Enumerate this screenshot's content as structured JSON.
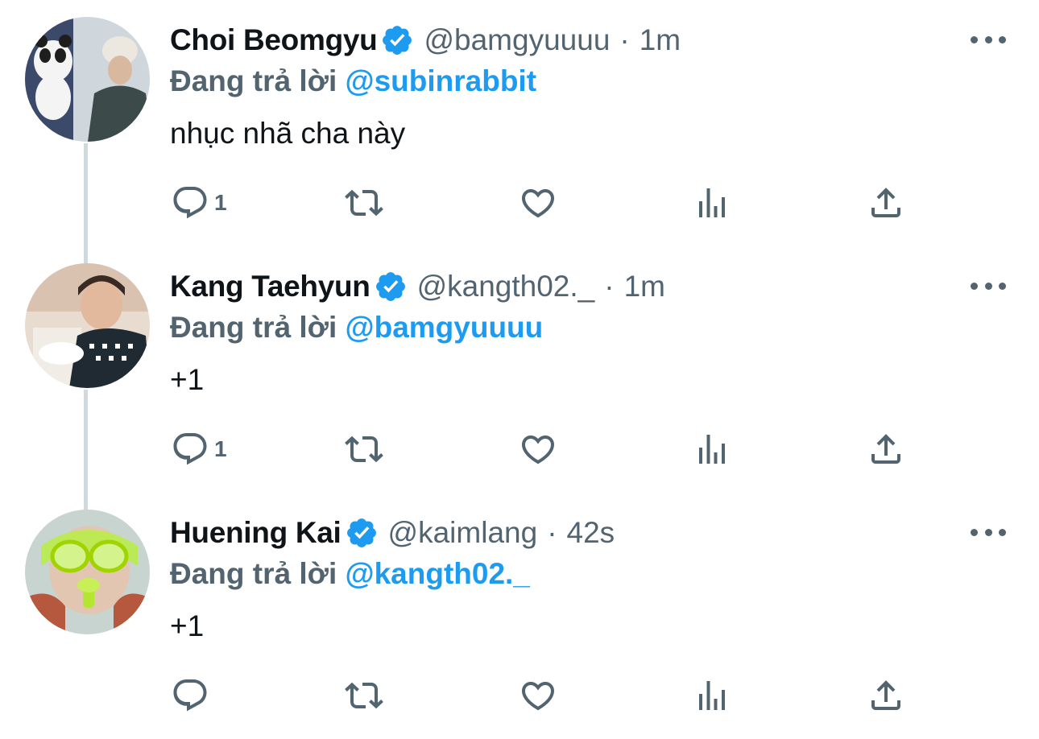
{
  "colors": {
    "text_primary": "#0f1419",
    "text_secondary": "#536471",
    "mention": "#1d9bf0",
    "verified": "#1d9bf0",
    "thread_line": "#cfd9de"
  },
  "icons": {
    "reply": "reply-icon",
    "retweet": "retweet-icon",
    "like": "heart-icon",
    "views": "analytics-icon",
    "share": "share-icon",
    "more": "more-horizontal-icon",
    "verified": "verified-badge-icon"
  },
  "tweets": [
    {
      "name": "Choi Beomgyu",
      "handle": "@bamgyuuuu",
      "separator": "·",
      "time": "1m",
      "reply_prefix": "Đang trả lời",
      "reply_to": "@subinrabbit",
      "text": "nhục nhã cha này",
      "reply_count": "1"
    },
    {
      "name": "Kang Taehyun",
      "handle": "@kangth02._",
      "separator": "·",
      "time": "1m",
      "reply_prefix": "Đang trả lời",
      "reply_to": "@bamgyuuuu",
      "text": "+1",
      "reply_count": "1"
    },
    {
      "name": "Huening Kai",
      "handle": "@kaimlang",
      "separator": "·",
      "time": "42s",
      "reply_prefix": "Đang trả lời",
      "reply_to": "@kangth02._",
      "text": "+1",
      "reply_count": ""
    }
  ]
}
